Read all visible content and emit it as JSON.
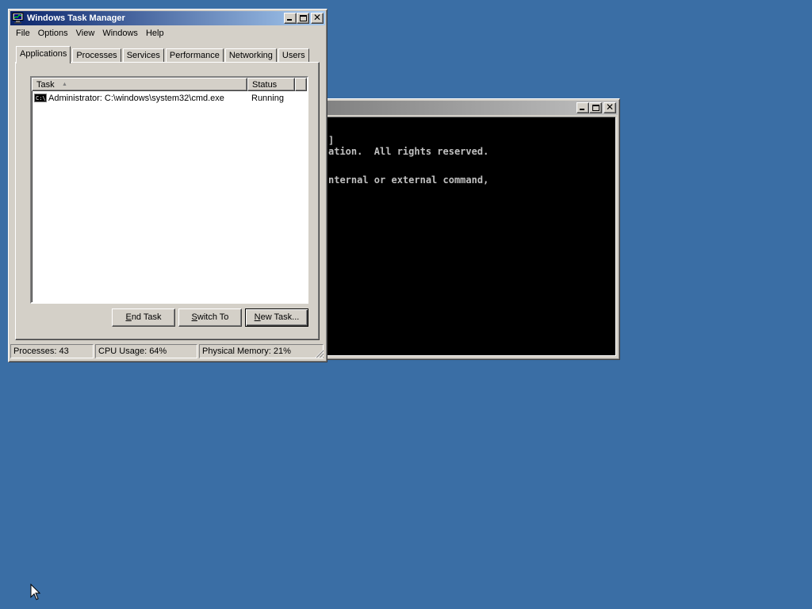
{
  "cmd_window": {
    "title": "",
    "lines": [
      "]",
      "ation.  All rights reserved.",
      "",
      "nternal or external command,"
    ]
  },
  "task_manager": {
    "title": "Windows Task Manager",
    "menu": [
      "File",
      "Options",
      "View",
      "Windows",
      "Help"
    ],
    "tabs": [
      "Applications",
      "Processes",
      "Services",
      "Performance",
      "Networking",
      "Users"
    ],
    "active_tab": "Applications",
    "columns": {
      "task": "Task",
      "status": "Status"
    },
    "rows": [
      {
        "task": "Administrator: C:\\windows\\system32\\cmd.exe",
        "status": "Running",
        "icon_text": "C:\\"
      }
    ],
    "buttons": {
      "end_task": {
        "hotkey": "E",
        "rest": "nd Task"
      },
      "switch_to": {
        "hotkey": "S",
        "rest": "witch To"
      },
      "new_task": {
        "hotkey": "N",
        "rest": "ew Task..."
      }
    },
    "status": {
      "processes": "Processes: 43",
      "cpu": "CPU Usage: 64%",
      "memory": "Physical Memory: 21%"
    }
  },
  "colors": {
    "desktop": "#3a6ea5",
    "active_title_start": "#0a246a",
    "active_title_end": "#a6caf0",
    "face": "#d4d0c8"
  },
  "icons": {
    "title_icon": "task-manager-monitor-icon",
    "row_icon": "cmd-prompt-icon",
    "cursor": "arrow-pointer-icon"
  }
}
